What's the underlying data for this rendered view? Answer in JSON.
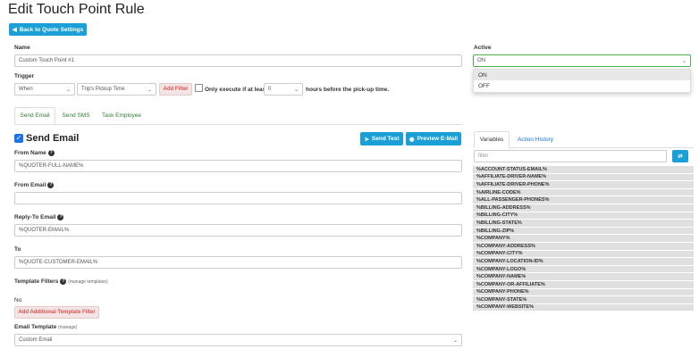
{
  "page_title": "Edit Touch Point Rule",
  "back_button": "Back to Quote Settings",
  "name": {
    "label": "Name",
    "value": "Custom Touch Point #1"
  },
  "active": {
    "label": "Active",
    "value": "ON",
    "options": [
      "ON",
      "OFF"
    ]
  },
  "trigger": {
    "label": "Trigger",
    "when": "When",
    "event": "Trip's Pickup Time",
    "add_filter": "Add Filter",
    "only_execute": "Only execute if at least",
    "hours_value": "0",
    "hours_suffix": "hours before the pick-up time."
  },
  "tabs": [
    "Send Email",
    "Send SMS",
    "Task Employee"
  ],
  "send_email": {
    "heading": "Send Email",
    "send_test": "Send Test",
    "preview": "Preview E-Mail",
    "from_name_label": "From Name",
    "from_name_value": "%QUOTER-FULL-NAME%",
    "from_email_label": "From Email",
    "from_email_value": "",
    "reply_to_label": "Reply-To Email",
    "reply_to_value": "%QUOTER-EMAIL%",
    "to_label": "To",
    "to_value": "%QUOTE-CUSTOMER-EMAIL%",
    "template_filters_label": "Template Filters",
    "manage_templates": "(manage templates)",
    "template_filters_value": "No",
    "add_template_filter": "Add Additional Template Filter",
    "email_template_label": "Email Template",
    "email_template_manage": "(manage)",
    "email_template_value": "Custom Email"
  },
  "side_tabs": [
    "Variables",
    "Action History"
  ],
  "filter_placeholder": "filter",
  "variables": [
    "%ACCOUNT-STATUS-EMAIL%",
    "%AFFILIATE-DRIVER-NAME%",
    "%AFFILIATE-DRIVER-PHONE%",
    "%AIRLINE-CODE%",
    "%ALL-PASSENGER-PHONES%",
    "%BILLING-ADDRESS%",
    "%BILLING-CITY%",
    "%BILLING-STATE%",
    "%BILLING-ZIP%",
    "%COMPANY%",
    "%COMPANY-ADDRESS%",
    "%COMPANY-CITY%",
    "%COMPANY-LOCATION-ID%",
    "%COMPANY-LOGO%",
    "%COMPANY-NAME%",
    "%COMPANY-OR-AFFILIATE%",
    "%COMPANY-PHONE%",
    "%COMPANY-STATE%",
    "%COMPANY-WEBSITE%"
  ]
}
